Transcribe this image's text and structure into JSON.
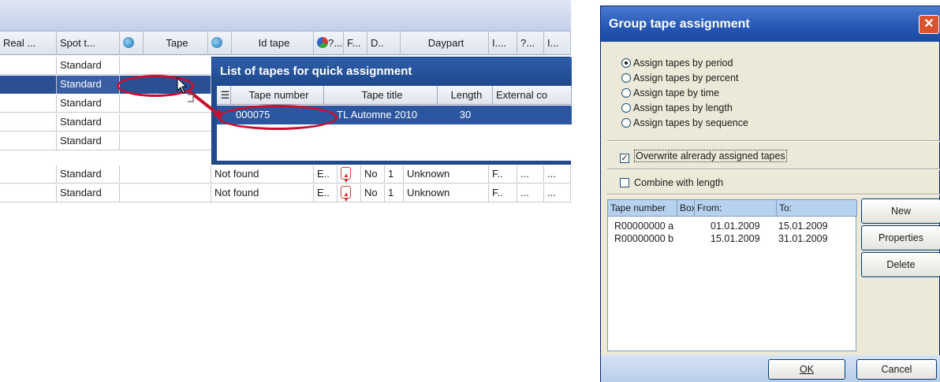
{
  "grid": {
    "columns": [
      "Real ...",
      "Spot t...",
      "Tape",
      "Id tape",
      "?...",
      "F...",
      "D..",
      "Daypart",
      "I....",
      "?...",
      "I..."
    ],
    "rows": [
      {
        "spot_type": "Standard"
      },
      {
        "spot_type": "Standard"
      },
      {
        "spot_type": "Standard"
      },
      {
        "spot_type": "Standard"
      },
      {
        "spot_type": "Standard"
      },
      {
        "spot_type": "Standard",
        "tape": "Not found",
        "f": "E..",
        "d": "No",
        "num": "1",
        "daypart": "Unknown",
        "i1": "F..",
        "i2": "...",
        "i3": "..."
      },
      {
        "spot_type": "Standard",
        "tape": "Not found",
        "f": "E..",
        "d": "No",
        "num": "1",
        "daypart": "Unknown",
        "i1": "F..",
        "i2": "...",
        "i3": "..."
      }
    ]
  },
  "popup": {
    "title": "List of tapes for quick assignment",
    "columns": [
      "Tape number",
      "Tape title",
      "Length",
      "External co"
    ],
    "row": {
      "tape_number": "000075",
      "tape_title": "TL Automne 2010",
      "length": "30"
    }
  },
  "dialog": {
    "title": "Group tape assignment",
    "close_label": "✕",
    "radios": [
      {
        "label": "Assign tapes by period",
        "checked": true
      },
      {
        "label": "Assign tapes by percent",
        "checked": false
      },
      {
        "label": "Assign tape by time",
        "checked": false
      },
      {
        "label": "Assign tapes by length",
        "checked": false
      },
      {
        "label": "Assign tapes by sequence",
        "checked": false
      }
    ],
    "overwrite_label": "Overwrite alrerady assigned tapes",
    "overwrite_checked": true,
    "combine_label": "Combine with length",
    "combine_checked": false,
    "list_columns": [
      "Tape number",
      "Box",
      "From:",
      "To:"
    ],
    "list_rows": [
      {
        "tape_number": "R00000000 a",
        "from": "01.01.2009",
        "to": "15.01.2009"
      },
      {
        "tape_number": "R00000000 b",
        "from": "15.01.2009",
        "to": "31.01.2009"
      }
    ],
    "buttons": {
      "new": "New",
      "properties": "Properties",
      "delete": "Delete",
      "ok": "OK",
      "cancel": "Cancel"
    }
  },
  "colors": {
    "selection": "#2a4f93",
    "highlight_ellipse": "#c8102e",
    "dialog_title": "#2456b4"
  }
}
